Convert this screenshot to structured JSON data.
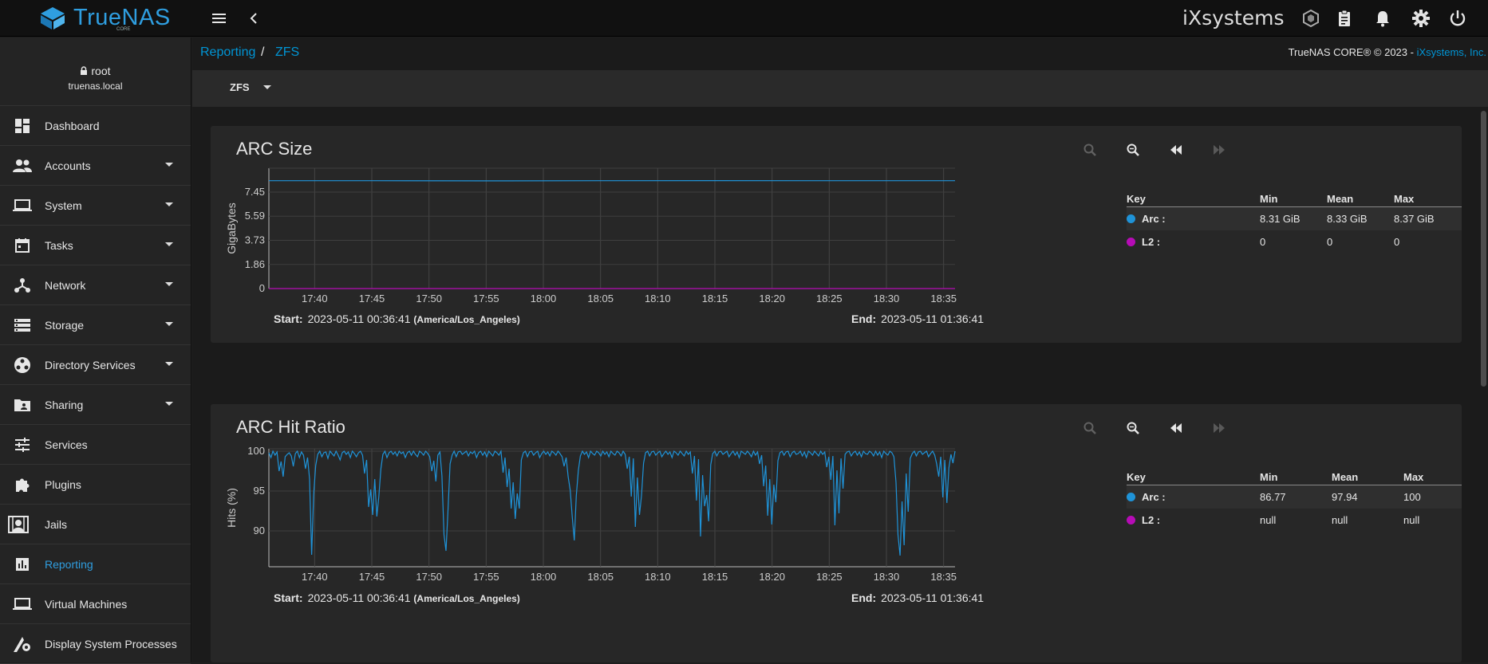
{
  "app": {
    "logo_text": "TrueNAS",
    "logo_sub": "CORE",
    "vendor_logo": "iXsystems"
  },
  "user": {
    "name": "root",
    "host": "truenas.local"
  },
  "sidebar": {
    "items": [
      {
        "label": "Dashboard",
        "icon": "dashboard-icon",
        "expandable": false,
        "active": false
      },
      {
        "label": "Accounts",
        "icon": "accounts-icon",
        "expandable": true,
        "active": false
      },
      {
        "label": "System",
        "icon": "laptop-icon",
        "expandable": true,
        "active": false
      },
      {
        "label": "Tasks",
        "icon": "calendar-icon",
        "expandable": true,
        "active": false
      },
      {
        "label": "Network",
        "icon": "network-icon",
        "expandable": true,
        "active": false
      },
      {
        "label": "Storage",
        "icon": "storage-icon",
        "expandable": true,
        "active": false
      },
      {
        "label": "Directory Services",
        "icon": "directory-icon",
        "expandable": true,
        "active": false
      },
      {
        "label": "Sharing",
        "icon": "folder-share-icon",
        "expandable": true,
        "active": false
      },
      {
        "label": "Services",
        "icon": "sliders-icon",
        "expandable": false,
        "active": false
      },
      {
        "label": "Plugins",
        "icon": "puzzle-icon",
        "expandable": false,
        "active": false
      },
      {
        "label": "Jails",
        "icon": "jail-icon",
        "expandable": false,
        "active": false
      },
      {
        "label": "Reporting",
        "icon": "bar-chart-icon",
        "expandable": false,
        "active": true
      },
      {
        "label": "Virtual Machines",
        "icon": "laptop-icon",
        "expandable": false,
        "active": false
      },
      {
        "label": "Display System Processes",
        "icon": "processes-icon",
        "expandable": false,
        "active": false
      }
    ]
  },
  "breadcrumb": {
    "parent": "Reporting",
    "sep": "/",
    "current": "ZFS"
  },
  "copyright": {
    "text": "TrueNAS CORE® © 2023 - ",
    "link": "iXsystems, Inc."
  },
  "toolbar": {
    "selected": "ZFS"
  },
  "colors": {
    "arc": "#1f93d8",
    "l2": "#b60cb6",
    "accent": "#0095d5"
  },
  "charts": [
    {
      "title": "ARC Size",
      "ylabel": "GigaBytes",
      "start_label": "Start:",
      "start_value": "2023-05-11 00:36:41",
      "timezone": "(America/Los_Angeles)",
      "end_label": "End:",
      "end_value": "2023-05-11 01:36:41",
      "legend": {
        "headers": [
          "Key",
          "Min",
          "Mean",
          "Max"
        ],
        "rows": [
          {
            "key": "Arc :",
            "min": "8.31 GiB",
            "mean": "8.33 GiB",
            "max": "8.37 GiB"
          },
          {
            "key": "L2 :",
            "min": "0",
            "mean": "0",
            "max": "0"
          }
        ]
      }
    },
    {
      "title": "ARC Hit Ratio",
      "ylabel": "Hits (%)",
      "start_label": "Start:",
      "start_value": "2023-05-11 00:36:41",
      "timezone": "(America/Los_Angeles)",
      "end_label": "End:",
      "end_value": "2023-05-11 01:36:41",
      "legend": {
        "headers": [
          "Key",
          "Min",
          "Mean",
          "Max"
        ],
        "rows": [
          {
            "key": "Arc :",
            "min": "86.77",
            "mean": "97.94",
            "max": "100"
          },
          {
            "key": "L2 :",
            "min": "null",
            "mean": "null",
            "max": "null"
          }
        ]
      }
    }
  ],
  "chart_data": [
    {
      "type": "line",
      "title": "ARC Size",
      "ylabel": "GigaBytes",
      "xlabel": "",
      "x_ticks": [
        "17:40",
        "17:45",
        "17:50",
        "17:55",
        "18:00",
        "18:05",
        "18:10",
        "18:15",
        "18:20",
        "18:25",
        "18:30",
        "18:35"
      ],
      "y_ticks": [
        "0",
        "1.86",
        "3.73",
        "5.59",
        "7.45"
      ],
      "ylim": [
        0,
        9.3
      ],
      "x_range": [
        "17:36",
        "18:36"
      ],
      "grid": true,
      "series": [
        {
          "name": "Arc",
          "color": "#1f93d8",
          "x": [
            "17:36",
            "17:45",
            "17:55",
            "18:05",
            "18:15",
            "18:25",
            "18:36"
          ],
          "values": [
            8.33,
            8.33,
            8.32,
            8.33,
            8.34,
            8.33,
            8.33
          ]
        },
        {
          "name": "L2",
          "color": "#b60cb6",
          "x": [
            "17:36",
            "18:36"
          ],
          "values": [
            0,
            0
          ]
        }
      ]
    },
    {
      "type": "line",
      "title": "ARC Hit Ratio",
      "ylabel": "Hits (%)",
      "xlabel": "",
      "x_ticks": [
        "17:40",
        "17:45",
        "17:50",
        "17:55",
        "18:00",
        "18:05",
        "18:10",
        "18:15",
        "18:20",
        "18:25",
        "18:30",
        "18:35"
      ],
      "y_ticks": [
        "90",
        "95",
        "100"
      ],
      "ylim": [
        85.5,
        100.3
      ],
      "x_range": [
        "17:36",
        "18:36"
      ],
      "grid": true,
      "series": [
        {
          "name": "Arc",
          "color": "#1f93d8",
          "values": [
            99.8,
            99.2,
            100,
            99.5,
            99.9,
            97.5,
            98.7,
            96.8,
            99.3,
            99.6,
            99.8,
            99.4,
            98.1,
            99.7,
            100,
            99.2,
            99.9,
            99.5,
            97.8,
            99.2,
            96.5,
            87,
            94.5,
            98.2,
            99.6,
            100,
            99.3,
            99.8,
            99.9,
            99.1,
            100,
            99.7,
            99.4,
            100,
            99.5,
            98.9,
            99.8,
            100,
            99.6,
            99.9,
            99.2,
            100,
            99.7,
            99.3,
            99.8,
            100,
            99.5,
            97.2,
            98.9,
            93,
            95.2,
            92,
            96.5,
            91.8,
            94.3,
            97.8,
            99.6,
            100,
            99.2,
            99.8,
            100,
            99.6,
            99.9,
            99.4,
            100,
            99.7,
            99.9,
            99.2,
            99.8,
            100,
            99.5,
            100,
            99.6,
            99.3,
            100,
            99.8,
            99.5,
            100,
            99.7,
            99.3,
            97.5,
            98.8,
            96.2,
            99.5,
            99.9,
            96.9,
            89.5,
            87.5,
            92.8,
            98.4,
            99.5,
            100,
            99.3,
            99.9,
            100,
            99.6,
            99.8,
            100,
            99.4,
            99.9,
            99.7,
            100,
            99.2,
            99.8,
            100,
            99.5,
            99.9,
            99.3,
            100,
            99.7,
            99.4,
            100,
            99.8,
            99.5,
            100,
            97.3,
            99.2,
            95.5,
            97.8,
            92.8,
            96.1,
            91.5,
            94.7,
            92.8,
            98.9,
            99.8,
            100,
            99.3,
            99.9,
            100,
            99.5,
            99.8,
            100,
            99.2,
            99.7,
            100,
            99.6,
            99.9,
            99.4,
            100,
            99.8,
            99.5,
            100,
            99.7,
            99.3,
            98.1,
            99.2,
            96.8,
            95.1,
            91.8,
            88.8,
            94.4,
            97.6,
            99.4,
            100,
            99.6,
            99.9,
            99.2,
            100,
            99.7,
            99.5,
            100,
            99.8,
            99.4,
            100,
            99.6,
            99.9,
            99.3,
            100,
            99.7,
            99.5,
            100,
            99.8,
            99.4,
            100,
            99.6,
            97.8,
            99.3,
            94.3,
            99.1,
            90.5,
            96.7,
            92,
            94.4,
            98.5,
            99.8,
            100,
            99.4,
            99.9,
            100,
            99.5,
            99.8,
            100,
            99.3,
            99.7,
            100,
            99.6,
            99.9,
            99.2,
            100,
            99.8,
            99.5,
            100,
            99.7,
            99.4,
            100,
            99.6,
            99.9,
            97.2,
            99.4,
            93.8,
            99,
            89.3,
            97,
            93.1,
            94.5,
            91.2,
            98.3,
            99.7,
            100,
            99.4,
            99.9,
            100,
            99.6,
            99.8,
            100,
            99.3,
            99.7,
            100,
            99.5,
            99.9,
            99.2,
            100,
            99.8,
            99.6,
            100,
            99.7,
            99.3,
            100,
            99.5,
            99.9,
            98.4,
            99.5,
            95.6,
            98.2,
            91.9,
            96.5,
            90.8,
            95.8,
            93.6,
            98.8,
            99.8,
            100,
            99.5,
            99.9,
            100,
            99.3,
            99.8,
            100,
            99.6,
            99.7,
            100,
            99.4,
            99.9,
            99.2,
            100,
            99.8,
            99.5,
            100,
            99.7,
            99.4,
            100,
            99.6,
            99.9,
            98,
            99.3,
            96.4,
            99.4,
            90.7,
            97.6,
            92.2,
            99.1,
            95.3,
            99.6,
            99.9,
            100,
            99.4,
            99.8,
            100,
            99.5,
            99.9,
            99.3,
            100,
            99.7,
            99.6,
            100,
            99.8,
            99.4,
            100,
            99.5,
            99.9,
            99.2,
            100,
            99.7,
            99.5,
            100,
            99.8,
            99.3,
            96.1,
            89.5,
            86.9,
            93.7,
            88.2,
            97.2,
            92.4,
            99.1,
            99.7,
            100,
            99.4,
            99.9,
            100,
            99.6,
            99.8,
            100,
            99.3,
            99.7,
            100,
            99.5,
            98.4,
            96.8,
            99.3,
            94.2,
            98.9,
            93.5,
            97.9,
            99.6,
            98.5,
            100
          ]
        },
        {
          "name": "L2",
          "color": "#b60cb6",
          "values": []
        }
      ]
    }
  ]
}
